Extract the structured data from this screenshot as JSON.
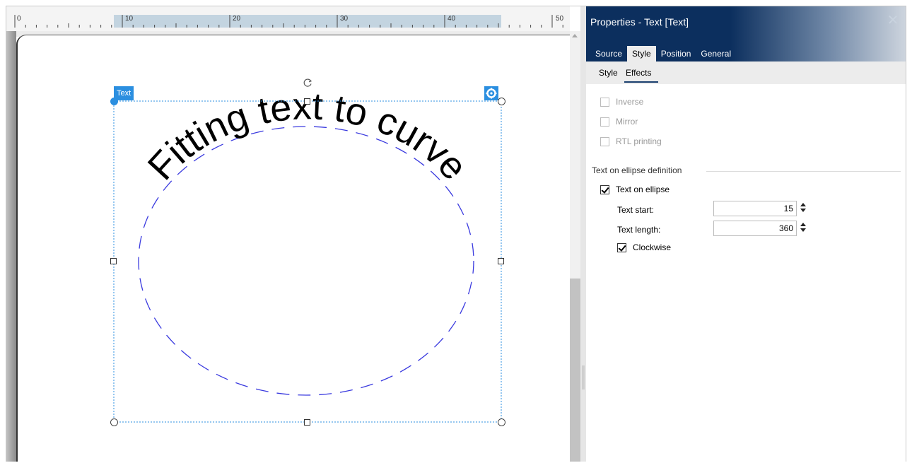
{
  "ruler": {
    "labels": [
      "0",
      "10",
      "20",
      "30",
      "40",
      "50"
    ]
  },
  "canvas": {
    "object_tag": "Text",
    "curve_text": "Fitting text to curve",
    "ellipse_stroke": "#3a3adf",
    "selection_color": "#2b8fe0"
  },
  "panel": {
    "title": "Properties - Text [Text]",
    "close_icon": "close-icon",
    "tabs": [
      {
        "label": "Source",
        "active": false
      },
      {
        "label": "Style",
        "active": true
      },
      {
        "label": "Position",
        "active": false
      },
      {
        "label": "General",
        "active": false
      }
    ],
    "subtabs": [
      {
        "label": "Style",
        "active": false
      },
      {
        "label": "Effects",
        "active": true
      }
    ],
    "effects": {
      "inverse": {
        "label": "Inverse",
        "checked": false,
        "enabled": false
      },
      "mirror": {
        "label": "Mirror",
        "checked": false,
        "enabled": false
      },
      "rtl": {
        "label": "RTL printing",
        "checked": false,
        "enabled": false
      }
    },
    "ellipse_group": {
      "title": "Text on ellipse definition",
      "enable": {
        "label": "Text on ellipse",
        "checked": true
      },
      "text_start": {
        "label": "Text start:",
        "value": "15"
      },
      "text_length": {
        "label": "Text length:",
        "value": "360"
      },
      "clockwise": {
        "label": "Clockwise",
        "checked": true
      }
    },
    "header_color": "#0c2f5e"
  }
}
